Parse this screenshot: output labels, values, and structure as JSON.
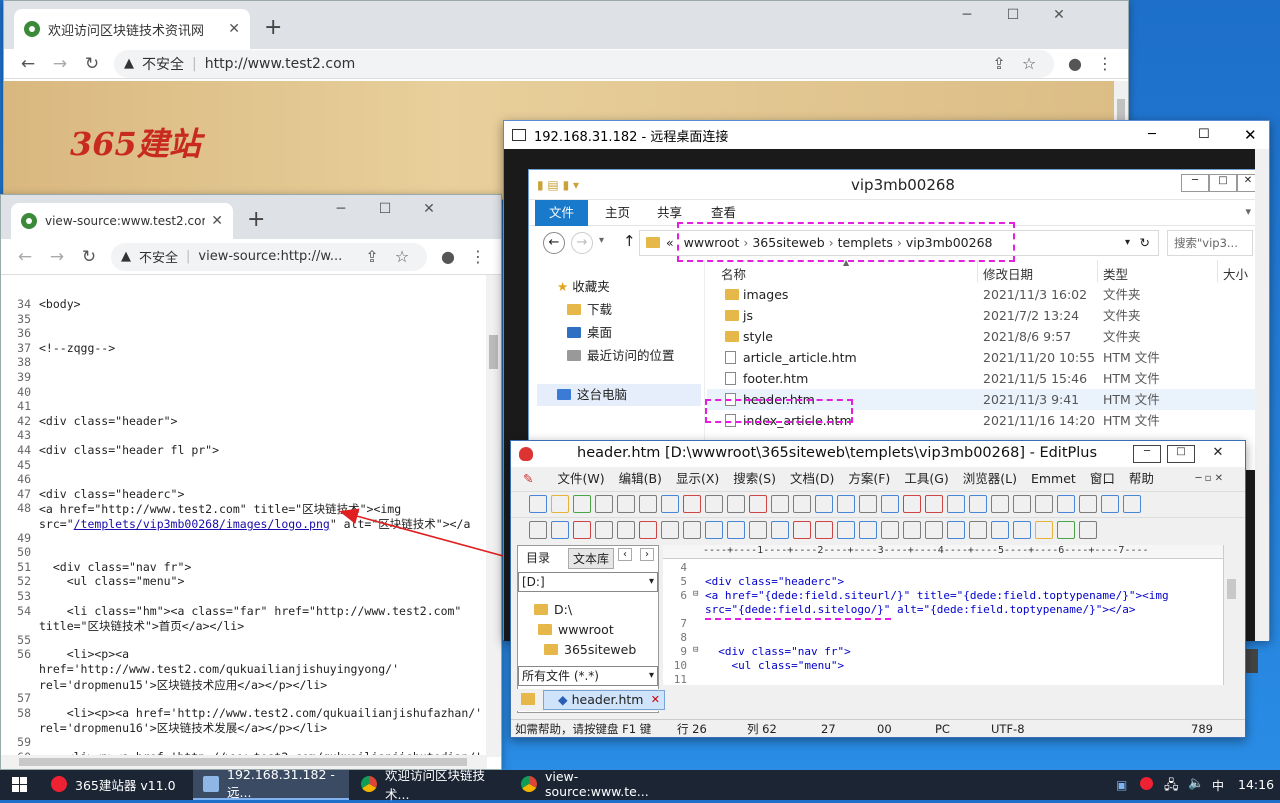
{
  "browser_main": {
    "tab_title": "欢迎访问区块链技术资讯网",
    "security": "不安全",
    "url": "http://www.test2.com",
    "logo_text": "365建站"
  },
  "browser_source": {
    "tab_title": "view-source:www.test2.com",
    "security": "不安全",
    "url": "view-source:http://w..."
  },
  "source_lines": [
    {
      "n": "34",
      "t": "<body>"
    },
    {
      "n": "35",
      "t": ""
    },
    {
      "n": "36",
      "t": ""
    },
    {
      "n": "37",
      "t": "<!--zqgg-->"
    },
    {
      "n": "38",
      "t": ""
    },
    {
      "n": "39",
      "t": ""
    },
    {
      "n": "40",
      "t": ""
    },
    {
      "n": "41",
      "t": ""
    },
    {
      "n": "42",
      "t": "<div class=\"header\">"
    },
    {
      "n": "43",
      "t": ""
    },
    {
      "n": "44",
      "t": "<div class=\"header fl pr\">"
    },
    {
      "n": "45",
      "t": ""
    },
    {
      "n": "46",
      "t": ""
    },
    {
      "n": "47",
      "t": "<div class=\"headerc\">"
    },
    {
      "n": "48",
      "t": "<a href=\"http://www.test2.com\" title=\"区块链技术\"><img"
    },
    {
      "n": "",
      "t": "src=\"/templets/vip3mb00268/images/logo.png\" alt=\"区块链技术\"></a"
    },
    {
      "n": "49",
      "t": ""
    },
    {
      "n": "50",
      "t": ""
    },
    {
      "n": "51",
      "t": "  <div class=\"nav fr\">"
    },
    {
      "n": "52",
      "t": "    <ul class=\"menu\">"
    },
    {
      "n": "53",
      "t": ""
    },
    {
      "n": "54",
      "t": "    <li class=\"hm\"><a class=\"far\" href=\"http://www.test2.com\""
    },
    {
      "n": "",
      "t": "title=\"区块链技术\">首页</a></li>"
    },
    {
      "n": "55",
      "t": ""
    },
    {
      "n": "56",
      "t": "    <li><p><a"
    },
    {
      "n": "",
      "t": "href='http://www.test2.com/qukuailianjishuyingyong/'"
    },
    {
      "n": "",
      "t": "rel='dropmenu15'>区块链技术应用</a></p></li>"
    },
    {
      "n": "57",
      "t": ""
    },
    {
      "n": "58",
      "t": "    <li><p><a href='http://www.test2.com/qukuailianjishufazhan/'"
    },
    {
      "n": "",
      "t": "rel='dropmenu16'>区块链技术发展</a></p></li>"
    },
    {
      "n": "59",
      "t": ""
    },
    {
      "n": "60",
      "t": "    <li><p><a href='http://www.test2.com/qukuailianjishutedian/'"
    }
  ],
  "rdp": {
    "title": "192.168.31.182 - 远程桌面连接"
  },
  "explorer": {
    "title": "vip3mb00268",
    "ribbon_tabs": [
      "文件",
      "主页",
      "共享",
      "查看"
    ],
    "breadcrumb": [
      "wwwroot",
      "365siteweb",
      "templets",
      "vip3mb00268"
    ],
    "search_placeholder": "搜索\"vip3...",
    "nav": [
      "收藏夹",
      "下载",
      "桌面",
      "最近访问的位置",
      "这台电脑"
    ],
    "columns": [
      "名称",
      "修改日期",
      "类型",
      "大小"
    ],
    "files": [
      {
        "name": "images",
        "date": "2021/11/3 16:02",
        "type": "文件夹",
        "folder": true
      },
      {
        "name": "js",
        "date": "2021/7/2 13:24",
        "type": "文件夹",
        "folder": true
      },
      {
        "name": "style",
        "date": "2021/8/6 9:57",
        "type": "文件夹",
        "folder": true
      },
      {
        "name": "article_article.htm",
        "date": "2021/11/20 10:55",
        "type": "HTM 文件",
        "folder": false
      },
      {
        "name": "footer.htm",
        "date": "2021/11/5 15:46",
        "type": "HTM 文件",
        "folder": false
      },
      {
        "name": "header.htm",
        "date": "2021/11/3 9:41",
        "type": "HTM 文件",
        "folder": false
      },
      {
        "name": "index_article.htm",
        "date": "2021/11/16 14:20",
        "type": "HTM 文件",
        "folder": false
      }
    ]
  },
  "editplus": {
    "title": "header.htm [D:\\wwwroot\\365siteweb\\templets\\vip3mb00268] - EditPlus",
    "menu": [
      "文件(W)",
      "编辑(B)",
      "显示(X)",
      "搜索(S)",
      "文档(D)",
      "方案(F)",
      "工具(G)",
      "浏览器(L)",
      "Emmet",
      "窗口",
      "帮助"
    ],
    "side_tabs": [
      "目录",
      "文本库"
    ],
    "drive": "[D:]",
    "tree": [
      "D:\\",
      "wwwroot",
      "365siteweb"
    ],
    "filter": "所有文件 (*.*)",
    "open_tab": "header.htm",
    "ruler": "----+----1----+----2----+----3----+----4----+----5----+----6----+----7----",
    "status": [
      "如需帮助，请按键盘 F1 键",
      "行 26",
      "列 62",
      "27",
      "00",
      "PC",
      "UTF-8",
      "789"
    ],
    "code_lines": [
      {
        "n": "4",
        "t": ""
      },
      {
        "n": "5",
        "t": "<div class=\"headerc\">"
      },
      {
        "n": "6",
        "t": "<a href=\"{dede:field.siteurl/}\" title=\"{dede:field.toptypename/}\"><img"
      },
      {
        "n": "",
        "t": "src=\"{dede:field.sitelogo/}\" alt=\"{dede:field.toptypename/}\"></a>"
      },
      {
        "n": "7",
        "t": ""
      },
      {
        "n": "8",
        "t": ""
      },
      {
        "n": "9",
        "t": "  <div class=\"nav fr\">"
      },
      {
        "n": "10",
        "t": "    <ul class=\"menu\">"
      },
      {
        "n": "11",
        "t": ""
      }
    ]
  },
  "taskbar": {
    "items": [
      "365建站器 v11.0",
      "192.168.31.182 - 远...",
      "欢迎访问区块链技术...",
      "view-source:www.te..."
    ],
    "time": "14:16"
  }
}
